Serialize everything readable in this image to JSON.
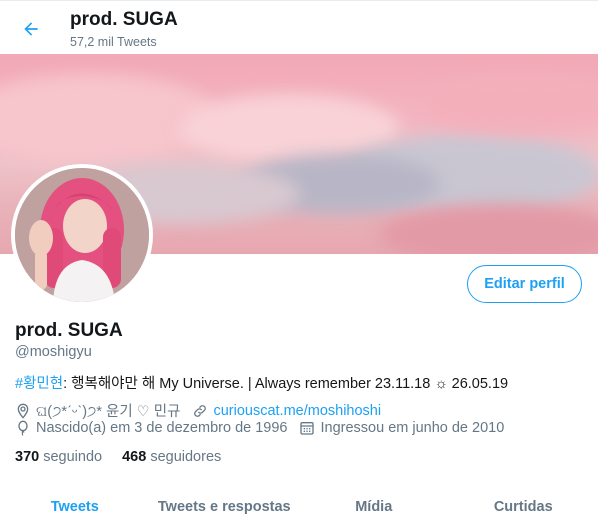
{
  "header": {
    "title": "prod. SUGA",
    "tweets_count": "57,2 mil Tweets"
  },
  "profile": {
    "name": "prod. SUGA",
    "handle": "@moshigyu",
    "edit_button": "Editar perfil",
    "bio_hashtag": "#황민현",
    "bio_text": ": 행복해야만 해 My Universe. | Always remember 23.11.18 ☼ 26.05.19",
    "location": "ଘ(੭*ˊᵕˋ)੭* 윤기 ♡ 민규",
    "website": "curiouscat.me/moshihoshi",
    "birthday": "Nascido(a) em 3 de dezembro de 1996",
    "joined": "Ingressou em junho de 2010"
  },
  "stats": {
    "following_count": "370",
    "following_label": "seguindo",
    "followers_count": "468",
    "followers_label": "seguidores"
  },
  "tabs": [
    {
      "label": "Tweets",
      "active": true
    },
    {
      "label": "Tweets e respostas",
      "active": false
    },
    {
      "label": "Mídia",
      "active": false
    },
    {
      "label": "Curtidas",
      "active": false
    }
  ],
  "colors": {
    "accent": "#1da1f2",
    "text_primary": "#14171a",
    "text_secondary": "#657786"
  },
  "icons": {
    "back": "arrow-left-icon",
    "location": "location-pin-icon",
    "website": "link-icon",
    "birthday": "balloon-icon",
    "joined": "calendar-icon"
  }
}
